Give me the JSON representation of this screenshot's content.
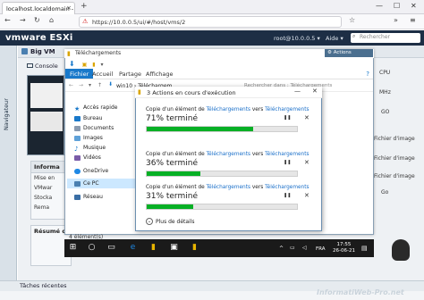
{
  "browser": {
    "tab_title": "localhost.localdomain - VMw",
    "url": "https://10.0.0.5/ui/#/host/vms/2",
    "new_tab": "+"
  },
  "esxi": {
    "logo": "vmware ESXi",
    "user": "root@10.0.0.5 ▾",
    "help": "Aide ▾",
    "search_placeholder": "Rechercher",
    "navigator": "Navigateur",
    "vm_name": "Big VM",
    "console_label": "Console",
    "actions_label": "Actions",
    "info_header": "Informa",
    "info_rows": [
      "Mise en",
      "VMwar",
      "Stocka",
      "Rema"
    ],
    "resume_header": "Résumé d",
    "right_info": [
      "CPU",
      "MHz",
      "GO",
      "Fichier d'image",
      "Fichier d'image",
      "Fichier d'image",
      "Go"
    ],
    "taches": "Tâches récentes",
    "watermark": "InformatiWeb-Pro.net"
  },
  "explorer": {
    "title": "Téléchargements",
    "ribbon_tabs": [
      "Fichier",
      "Accueil",
      "Partage",
      "Affichage"
    ],
    "address": "win10 › Téléchargem...",
    "search_placeholder": "Rechercher dans : Téléchargements",
    "nav_items": [
      "Accès rapide",
      "Bureau",
      "Documents",
      "Images",
      "Musique",
      "Vidéos",
      "OneDrive",
      "Ce PC",
      "Réseau"
    ],
    "status": "4 élément(s)"
  },
  "copy_dialog": {
    "title": "3 Actions en cours d'exécution",
    "ops": [
      {
        "line_prefix": "Copie d'un élément de",
        "from": "Téléchargements",
        "to_prefix": "vers",
        "to": "Téléchargements",
        "percent_label": "71% terminé",
        "progress": 0.71
      },
      {
        "line_prefix": "Copie d'un élément de",
        "from": "Téléchargements",
        "to_prefix": "vers",
        "to": "Téléchargements",
        "percent_label": "36% terminé",
        "progress": 0.36
      },
      {
        "line_prefix": "Copie d'un élément de",
        "from": "Téléchargements",
        "to_prefix": "vers",
        "to": "Téléchargements",
        "percent_label": "31% terminé",
        "progress": 0.31
      }
    ],
    "details": "Plus de détails"
  },
  "win_taskbar": {
    "lang": "FRA",
    "time": "17:55",
    "date": "26-06-21"
  },
  "colors": {
    "esxi_header": "#1d2e45",
    "progress_green": "#06b025",
    "fichier_blue": "#1979ca",
    "link_blue": "#1a6fc9"
  }
}
